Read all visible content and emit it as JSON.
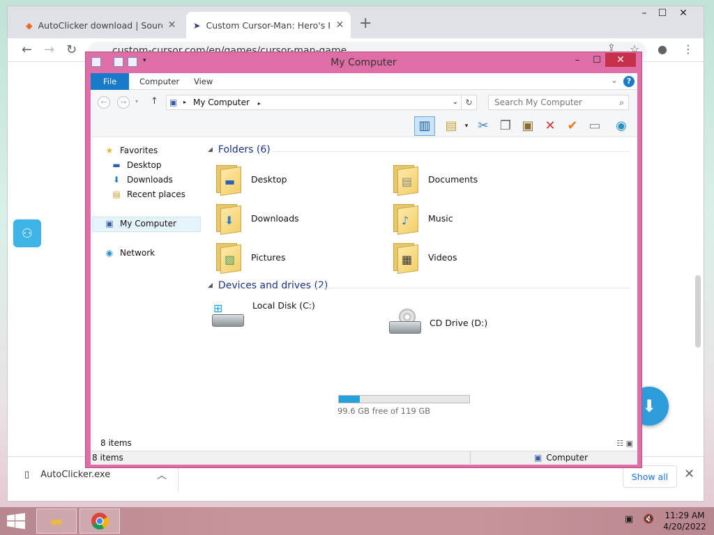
{
  "browser": {
    "tabs": [
      {
        "title": "AutoClicker download | SourceFo",
        "active": false
      },
      {
        "title": "Custom Cursor-Man: Hero's Rise",
        "active": true
      }
    ],
    "new_tab": "+",
    "url": "custom-cursor.com/en/games/cursor-man-game",
    "download_shelf": {
      "file": "AutoClicker.exe",
      "show_all": "Show all"
    }
  },
  "explorer": {
    "title": "My Computer",
    "ribbon_tabs": [
      "File",
      "Computer",
      "View"
    ],
    "help": "?",
    "address": "My Computer",
    "search_placeholder": "Search My Computer",
    "nav": {
      "favorites": "Favorites",
      "desktop": "Desktop",
      "downloads": "Downloads",
      "recent": "Recent places",
      "computer": "My Computer",
      "network": "Network"
    },
    "groups": {
      "folders": "Folders (6)",
      "devices": "Devices and drives (2)"
    },
    "folders": [
      "Desktop",
      "Documents",
      "Downloads",
      "Music",
      "Pictures",
      "Videos"
    ],
    "drives": {
      "c_label": "Local Disk (C:)",
      "c_free": "99.6 GB free of 119 GB",
      "c_used_fraction": 0.163,
      "d_label": "CD Drive (D:)"
    },
    "status_items": "8 items",
    "status_zone": "Computer"
  },
  "taskbar": {
    "time": "11:29 AM",
    "date": "4/20/2022"
  },
  "colors": {
    "window_frame": "#de6ea5",
    "ribbon_file": "#1979ca",
    "close_button": "#c7304a",
    "accent_blue": "#2d9cdb"
  }
}
